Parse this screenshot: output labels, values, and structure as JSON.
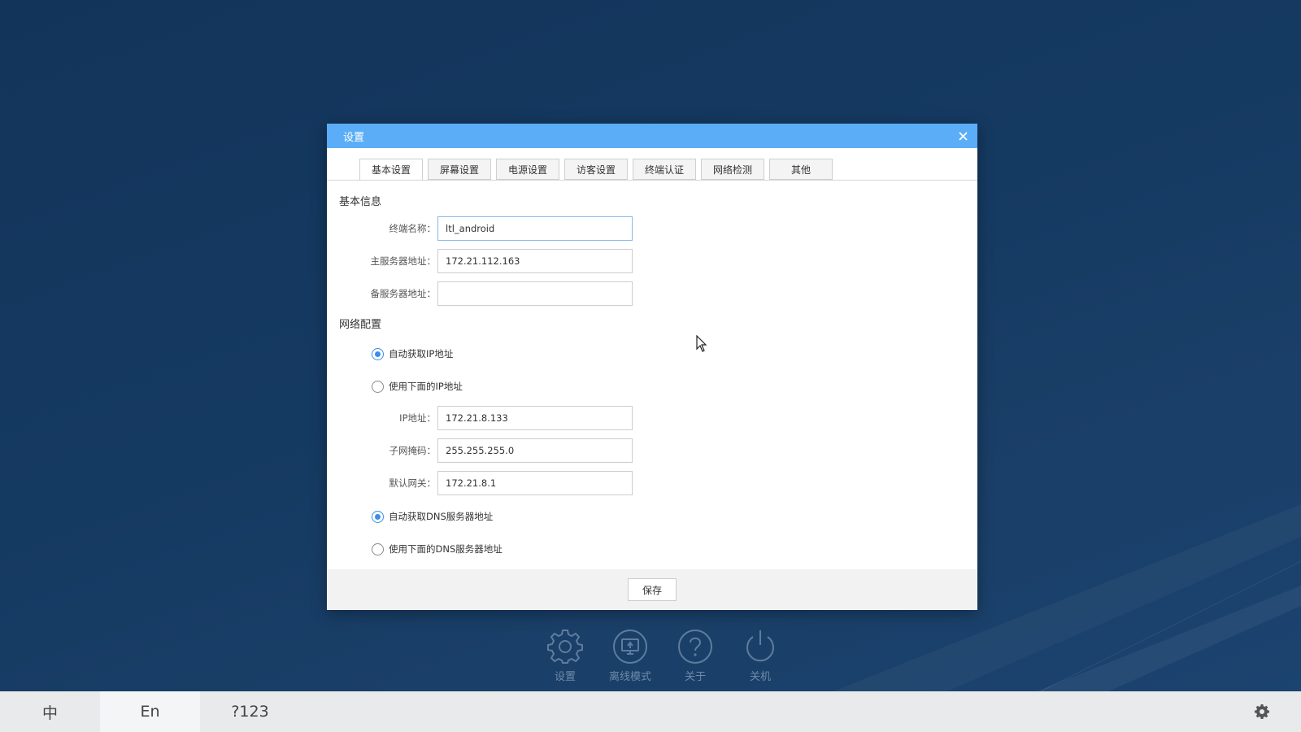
{
  "dialog": {
    "title": "设置",
    "tabs": [
      {
        "label": "基本设置",
        "active": true
      },
      {
        "label": "屏幕设置"
      },
      {
        "label": "电源设置"
      },
      {
        "label": "访客设置"
      },
      {
        "label": "终端认证"
      },
      {
        "label": "网络检测"
      },
      {
        "label": "其他"
      }
    ],
    "basic_info": {
      "title": "基本信息",
      "terminal_name_label": "终端名称：",
      "terminal_name_value": "ltl_android",
      "primary_server_label": "主服务器地址：",
      "primary_server_value": "172.21.112.163",
      "backup_server_label": "备服务器地址：",
      "backup_server_value": ""
    },
    "network": {
      "title": "网络配置",
      "auto_ip_label": "自动获取IP地址",
      "manual_ip_label": "使用下面的IP地址",
      "ip_label": "IP地址：",
      "ip_value": "172.21.8.133",
      "subnet_label": "子网掩码：",
      "subnet_value": "255.255.255.0",
      "gateway_label": "默认网关：",
      "gateway_value": "172.21.8.1",
      "auto_dns_label": "自动获取DNS服务器地址",
      "manual_dns_label": "使用下面的DNS服务器地址"
    },
    "save_label": "保存"
  },
  "dock": [
    {
      "label": "设置",
      "icon": "gear-icon"
    },
    {
      "label": "离线模式",
      "icon": "offline-monitor-icon"
    },
    {
      "label": "关于",
      "icon": "help-icon"
    },
    {
      "label": "关机",
      "icon": "power-icon"
    }
  ],
  "keyboard": {
    "keys": [
      "中",
      "En",
      "?123"
    ]
  },
  "colors": {
    "title_bar": "#5aadf6",
    "radio_accent": "#3a8ee6",
    "background": "#153a62"
  }
}
